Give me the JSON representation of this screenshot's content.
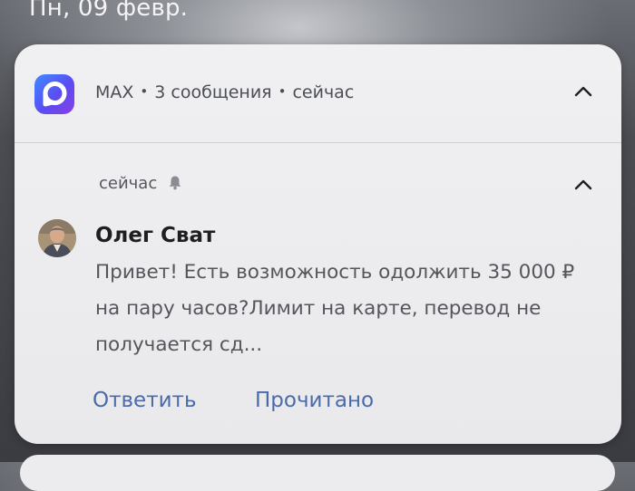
{
  "status": {
    "date": "Пн, 09 февр."
  },
  "notification": {
    "app_name": "MAX",
    "message_count": "3 сообщения",
    "time": "сейчас",
    "separator": "•",
    "conversation": {
      "time": "сейчас",
      "sender": "Олег Сват",
      "text": "Привет! Есть возможность одолжить 35 000 ₽ на пару часов?Лимит на карте, перевод не получается сд..."
    },
    "actions": {
      "reply_label": "Ответить",
      "read_label": "Прочитано"
    }
  },
  "icons": {
    "app": "max-app-icon",
    "expand": "chevron-up-icon",
    "bell": "bell-icon",
    "avatar": "avatar"
  },
  "colors": {
    "accent": "#4a6aa8",
    "app_gradient_start": "#3f8bff",
    "app_gradient_end": "#8a3fe6"
  }
}
